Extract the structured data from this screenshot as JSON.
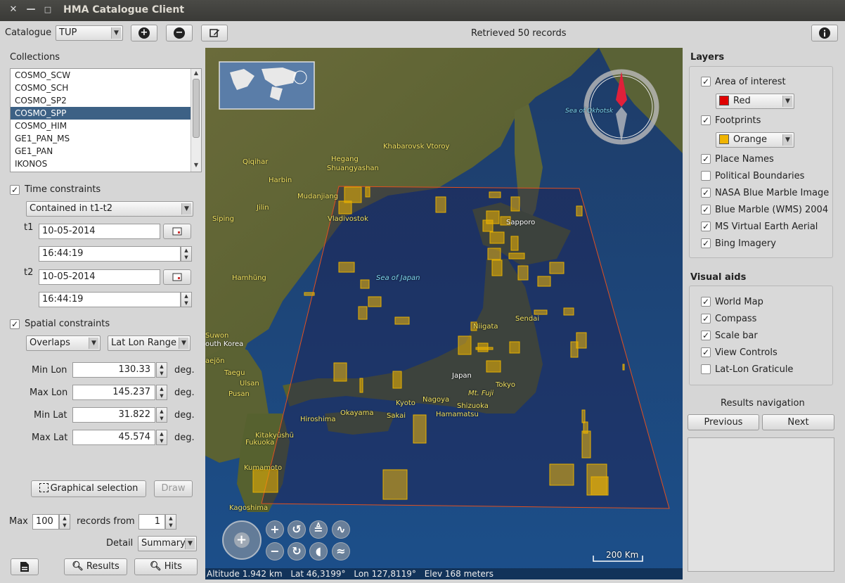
{
  "window": {
    "title": "HMA Catalogue Client",
    "close": "✕",
    "minimize": "—",
    "maximize": "□"
  },
  "toolbar": {
    "catalogue_label": "Catalogue",
    "catalogue_value": "TUP",
    "add_icon": "+",
    "remove_icon": "−",
    "status": "Retrieved 50 records"
  },
  "collections": {
    "label": "Collections",
    "items": [
      "COSMO_SCW",
      "COSMO_SCH",
      "COSMO_SP2",
      "COSMO_SPP",
      "COSMO_HIM",
      "GE1_PAN_MS",
      "GE1_PAN",
      "IKONOS"
    ],
    "selected": "COSMO_SPP"
  },
  "time": {
    "label": "Time constraints",
    "checked": true,
    "mode": "Contained in t1-t2",
    "t1_label": "t1",
    "t1_date": "10-05-2014",
    "t1_time": "16:44:19",
    "t2_label": "t2",
    "t2_date": "10-05-2014",
    "t2_time": "16:44:19"
  },
  "spatial": {
    "label": "Spatial constraints",
    "checked": true,
    "operator": "Overlaps",
    "mode": "Lat Lon Range",
    "min_lon_label": "Min Lon",
    "min_lon": "130.33",
    "max_lon_label": "Max Lon",
    "max_lon": "145.237",
    "min_lat_label": "Min Lat",
    "min_lat": "31.822",
    "max_lat_label": "Max Lat",
    "max_lat": "45.574",
    "unit": "deg."
  },
  "selection": {
    "graphical_label": "Graphical selection",
    "draw_label": "Draw"
  },
  "paging": {
    "max_label": "Max",
    "max_value": "100",
    "records_from_label": "records from",
    "records_from_value": "1",
    "detail_label": "Detail",
    "detail_value": "Summary"
  },
  "bottom": {
    "results_label": "Results",
    "hits_label": "Hits"
  },
  "map": {
    "labels": {
      "qiqihar": "Qiqihar",
      "harbin": "Harbin",
      "hegang": "Hegang",
      "shuangyashan": "Shuangyashan",
      "khabarovsk": "Khabarovsk Vtoroy",
      "mudanjiang": "Mudanjiang",
      "jilin": "Jilin",
      "siping": "Siping",
      "vladivostok": "Vladivostok",
      "sapporo": "Sapporo",
      "hamhung": "Hamhŭng",
      "sea_of_japan": "Sea of Japan",
      "sea_of_okhotsk": "Sea of Okhotsk",
      "sendai": "Sendai",
      "niigata": "Niigata",
      "suwon": "Suwon",
      "south_korea": "outh Korea",
      "taejon": "aejŏn",
      "taegu": "Taegu",
      "ulsan": "Ulsan",
      "pusan": "Pusan",
      "japan": "Japan",
      "tokyo": "Tokyo",
      "mt_fuji": "Mt. Fuji",
      "kyoto": "Kyoto",
      "nagoya": "Nagoya",
      "shizuoka": "Shizuoka",
      "hamamatsu": "Hamamatsu",
      "okayama": "Okayama",
      "hiroshima": "Hiroshima",
      "sakai": "Sakai",
      "kitakyushu": "Kitakyūshū",
      "fukuoka": "Fukuoka",
      "kumamoto": "Kumamoto",
      "kagoshima": "Kagoshima"
    },
    "scale_bar": "200 Km",
    "altitude": "Altitude 1.942 km",
    "lat": "Lat 46,3199°",
    "lon": "Lon 127,8119°",
    "elev": "Elev 168 meters"
  },
  "layers": {
    "title": "Layers",
    "area_of_interest": "Area of interest",
    "aoi_color_label": "Red",
    "aoi_color": "#e00000",
    "footprints": "Footprints",
    "footprints_color_label": "Orange",
    "footprints_color": "#f0b400",
    "place_names": "Place Names",
    "political_boundaries": "Political Boundaries",
    "nasa_blue_marble": "NASA Blue Marble Image",
    "blue_marble_wms": "Blue Marble (WMS) 2004",
    "ms_virtual_earth": "MS Virtual Earth Aerial",
    "bing": "Bing Imagery"
  },
  "visual_aids": {
    "title": "Visual aids",
    "world_map": "World Map",
    "compass": "Compass",
    "scale_bar": "Scale bar",
    "view_controls": "View Controls",
    "graticule": "Lat-Lon Graticule"
  },
  "navigation": {
    "title": "Results navigation",
    "previous": "Previous",
    "next": "Next"
  }
}
